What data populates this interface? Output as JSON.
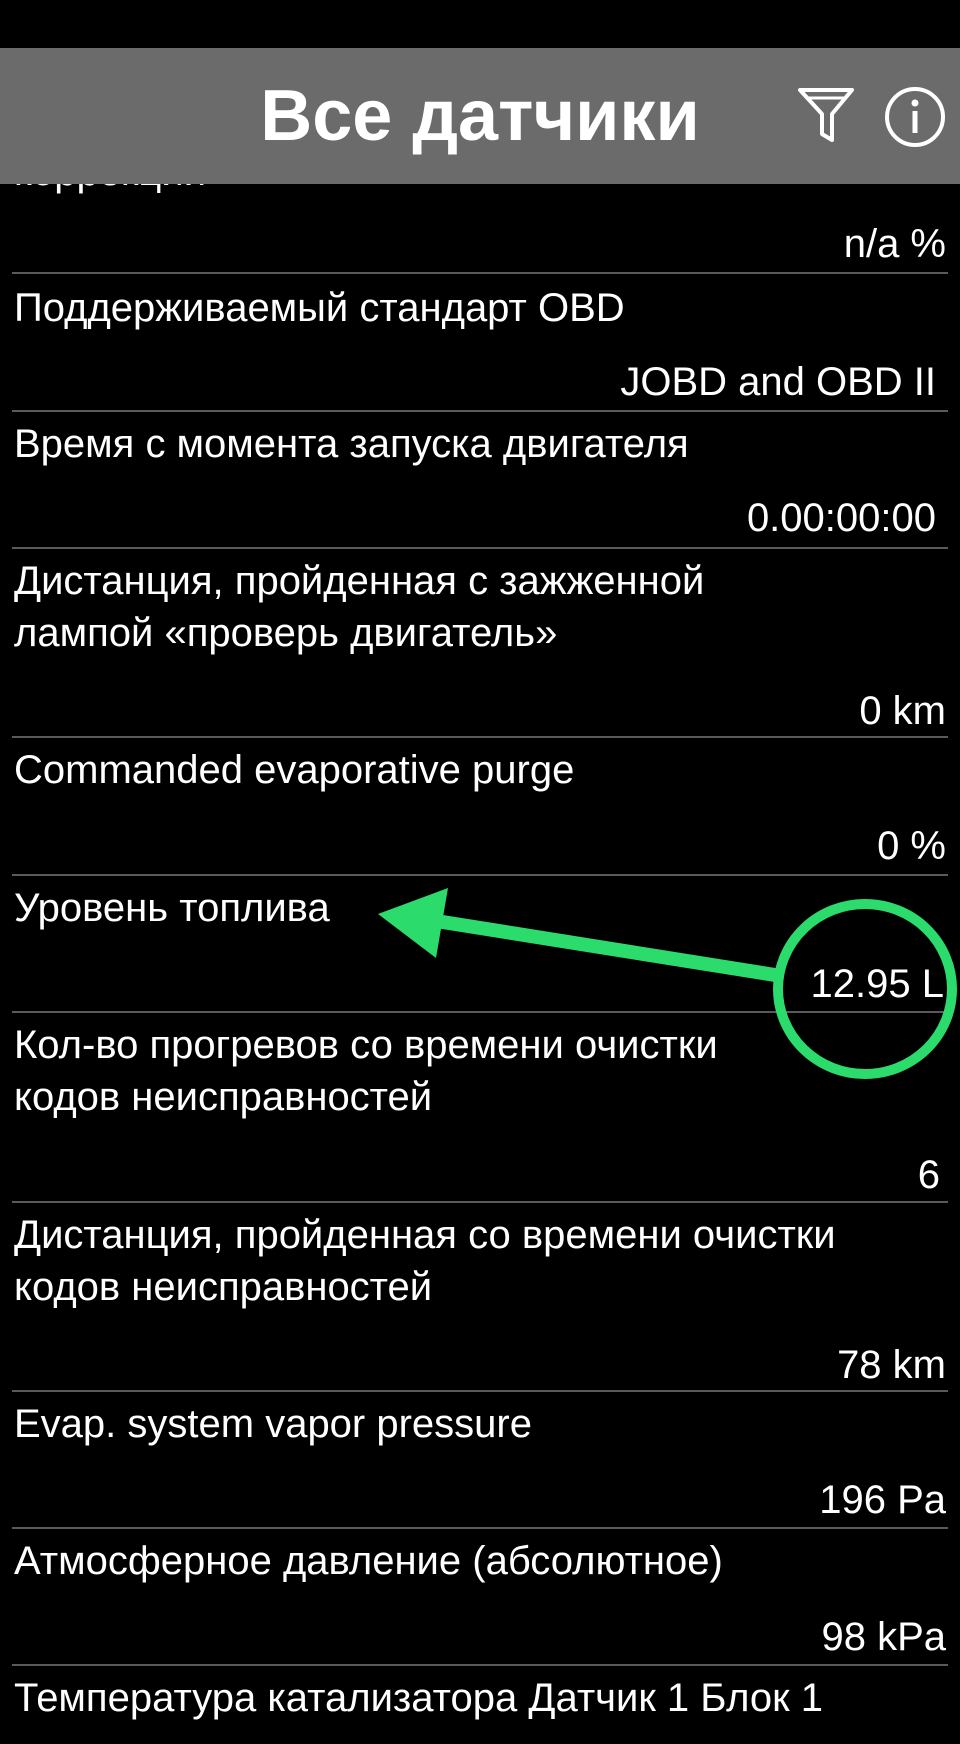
{
  "app_bar": {
    "title": "Все датчики",
    "filter_icon": "filter-icon",
    "info_icon": "info-icon"
  },
  "top_partial_label": "коррекции",
  "sensors": [
    {
      "label": "",
      "value": "n/a %"
    },
    {
      "label": "Поддерживаемый стандарт OBD",
      "value": "JOBD and OBD II"
    },
    {
      "label": "Время с момента запуска двигателя",
      "value": "0.00:00:00"
    },
    {
      "label": "Дистанция, пройденная с зажженной лампой «проверь двигатель»",
      "value": "0 km"
    },
    {
      "label": "Commanded evaporative purge",
      "value": "0 %"
    },
    {
      "label": "Уровень топлива",
      "value": "12.95 L"
    },
    {
      "label": "Кол-во прогревов со времени очистки кодов неисправностей",
      "value": "6"
    },
    {
      "label": "Дистанция, пройденная со времени очистки кодов неисправностей",
      "value": "78 km"
    },
    {
      "label": "Evap. system vapor pressure",
      "value": "196 Pa"
    },
    {
      "label": "Атмосферное давление (абсолютное)",
      "value": "98 kPa"
    },
    {
      "label": "Температура катализатора Датчик 1 Блок 1",
      "value": ""
    }
  ],
  "annotation": {
    "color": "#2bdc6c",
    "shapes": "arrow pointing to fuel level label, circle around fuel level value"
  }
}
